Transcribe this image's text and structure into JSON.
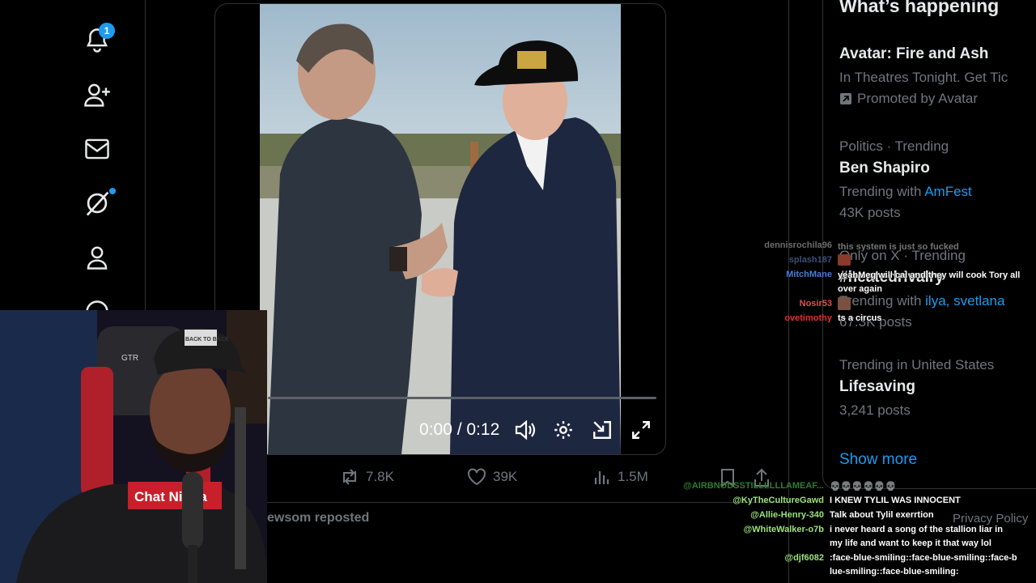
{
  "nav": {
    "notification_badge": "1",
    "icons": [
      "bell-icon",
      "follow-icon",
      "mail-icon",
      "grok-icon",
      "profile-icon",
      "more-icon"
    ]
  },
  "video": {
    "time": "0:00 / 0:12",
    "progress_fraction": 0
  },
  "actions": {
    "reposts": "7.8K",
    "likes": "39K",
    "views": "1.5M"
  },
  "next_post": {
    "reposted_text": "ewsom reposted"
  },
  "sidebar": {
    "heading": "What’s happening",
    "trends": [
      {
        "title": "Avatar: Fire and Ash",
        "line1": "In Theatres Tonight. Get Tic",
        "line2": "Promoted by Avatar"
      },
      {
        "category": "Politics · Trending",
        "title": "Ben Shapiro",
        "with_label": "Trending with",
        "with_link": "AmFest",
        "count": "43K posts"
      },
      {
        "category": "Only on X · Trending",
        "title": "#heatedrivalry",
        "with_label": "Trending with",
        "with_link": "ilya, svetlana",
        "count": "67.3K posts"
      },
      {
        "category": "Trending in United States",
        "title": "Lifesaving",
        "count": "3,241 posts"
      }
    ],
    "show_more": "Show more",
    "footer": "Privacy Policy"
  },
  "chat_top": [
    {
      "user": "dennisrochila96",
      "msg": "this system is just so fucked",
      "color": "#6b6b6b"
    },
    {
      "user": "splash187",
      "msg": "",
      "color": "#3d4f7a"
    },
    {
      "user": "MitchMane",
      "msg": "yeahMeg will cal and they will cook Tory all over again",
      "color": "#4a7bd8"
    },
    {
      "user": "Nosir53",
      "msg": "",
      "color": "#e05050"
    },
    {
      "user": "ovetimothy",
      "msg": "ts a circus",
      "color": "#e03030"
    }
  ],
  "chat_bottom": [
    {
      "user": "@AIRBNODSSTILLLLLLAMEAF...",
      "msg": "💀💀💀💀💀💀",
      "color": "#2e7d32"
    },
    {
      "user": "@KyTheCultureGawd",
      "msg": "I KNEW TYLIL WAS INNOCENT",
      "color": "#9be37a"
    },
    {
      "user": "@Allie-Henry-340",
      "msg": "Talk about Tylil exerrtion",
      "color": "#9be37a"
    },
    {
      "user": "@WhiteWalker-o7b",
      "msg": "i never heard a song of the stallion liar in my life and want to keep it that way lol",
      "color": "#9be37a"
    },
    {
      "user": "@djf6082",
      "msg": ":face-blue-smiling::face-blue-smiling::face-blue-smiling::face-blue-smiling:",
      "color": "#9be37a"
    }
  ],
  "webcam": {
    "hat_text": "BACK TO BACK",
    "shirt_text": "Chat Nigga",
    "chair_text": "GTR"
  }
}
